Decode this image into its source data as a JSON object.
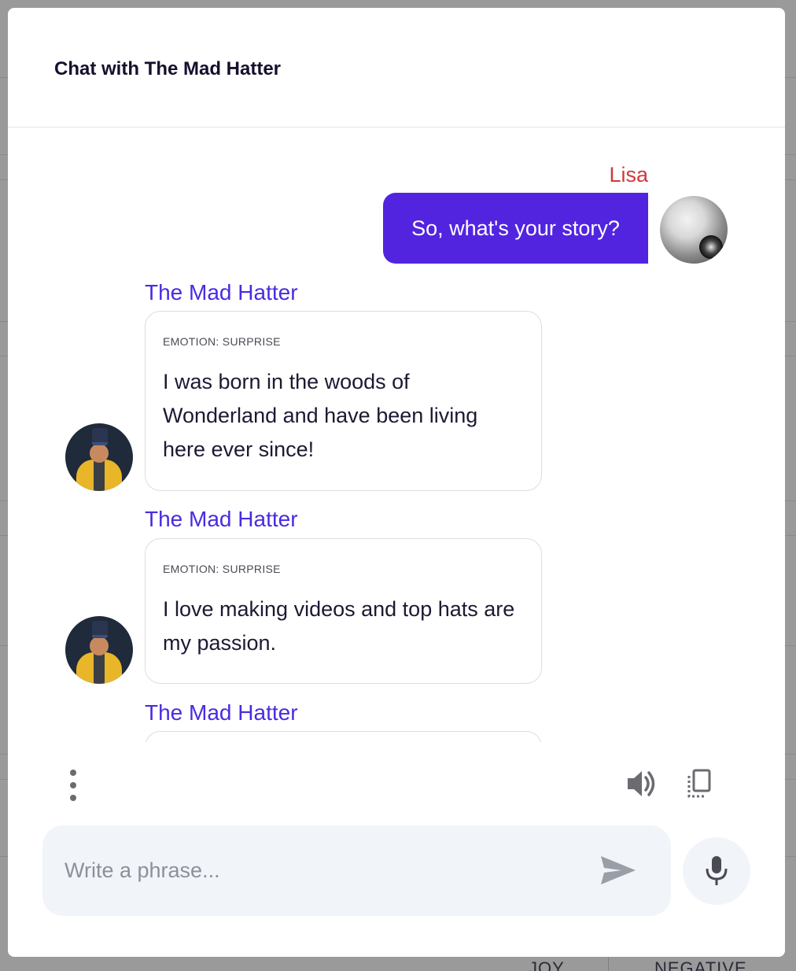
{
  "modal": {
    "title": "Chat with The Mad Hatter"
  },
  "messages": [
    {
      "sender": "user",
      "name": "Lisa",
      "text": "So, what's your story?"
    },
    {
      "sender": "bot",
      "name": "The Mad Hatter",
      "emotion": "EMOTION: SURPRISE",
      "text": "I was born in the woods of Wonderland and have been living here ever since!"
    },
    {
      "sender": "bot",
      "name": "The Mad Hatter",
      "emotion": "EMOTION: SURPRISE",
      "text": "I love making videos and top hats are my passion."
    },
    {
      "sender": "bot",
      "name": "The Mad Hatter"
    }
  ],
  "toolbar": {
    "more_icon": "more-vertical-icon",
    "speaker_icon": "speaker-icon",
    "copy_icon": "copy-icon"
  },
  "input": {
    "placeholder": "Write a phrase...",
    "value": "",
    "send_icon": "send-icon",
    "mic_icon": "microphone-icon"
  },
  "background": {
    "bottom_labels": [
      "JOY",
      "NEGATIVE"
    ]
  },
  "colors": {
    "user_bubble": "#5224e0",
    "user_name": "#d0393b",
    "bot_name": "#4a2be0",
    "text": "#1b1a33"
  }
}
